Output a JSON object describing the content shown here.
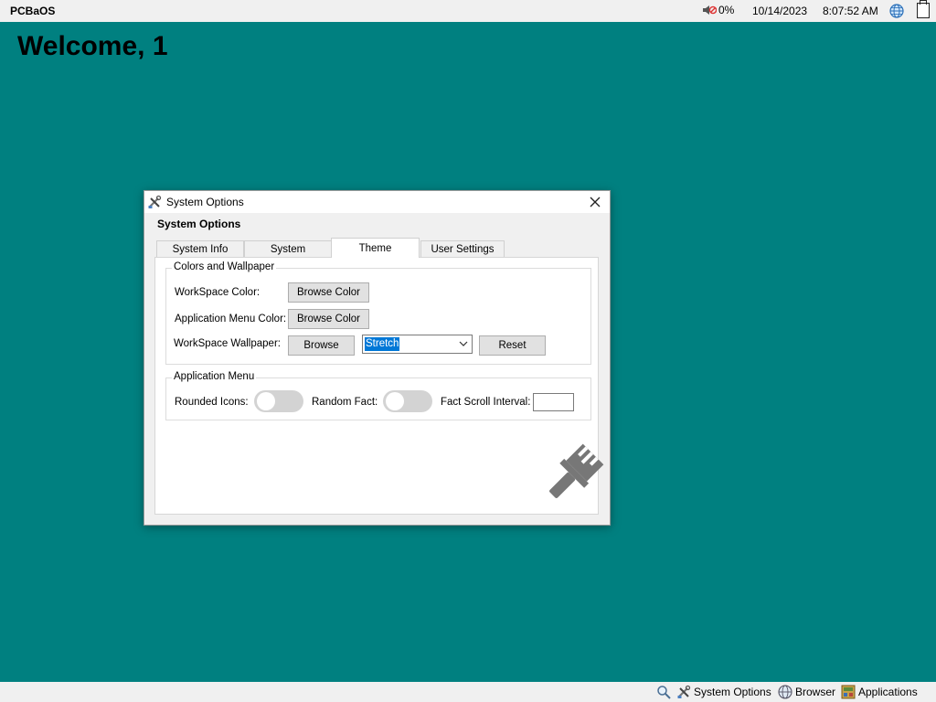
{
  "topbar": {
    "brand": "PCBaOS",
    "volume_icon": "speaker-muted-icon",
    "volume": "0%",
    "date": "10/14/2023",
    "time": "8:07:52 AM",
    "globe_icon": "globe-icon",
    "exit_icon": "exit-icon"
  },
  "desktop": {
    "welcome": "Welcome, 1",
    "background_color": "#008080"
  },
  "window": {
    "title": "System Options",
    "heading": "System Options",
    "close_icon": "close-icon",
    "tabs": [
      {
        "label": "System Info",
        "active": false
      },
      {
        "label": "System",
        "active": false
      },
      {
        "label": "Theme",
        "active": true
      },
      {
        "label": "User Settings",
        "active": false
      }
    ],
    "colors_group": {
      "title": "Colors and Wallpaper",
      "workspace_color_label": "WorkSpace Color:",
      "workspace_color_button": "Browse Color",
      "app_menu_color_label": "Application Menu Color:",
      "app_menu_color_button": "Browse Color",
      "wallpaper_label": "WorkSpace Wallpaper:",
      "wallpaper_browse_button": "Browse",
      "wallpaper_mode_selected": "Stretch",
      "wallpaper_reset_button": "Reset"
    },
    "app_menu_group": {
      "title": "Application Menu",
      "rounded_icons_label": "Rounded Icons:",
      "rounded_icons_on": false,
      "random_fact_label": "Random Fact:",
      "random_fact_on": false,
      "fact_scroll_label": "Fact Scroll Interval:",
      "fact_scroll_value": ""
    },
    "decor_icon": "paintbrush-icon"
  },
  "taskbar": {
    "search_icon": "search-icon",
    "items": [
      {
        "label": "System Options",
        "icon": "tools-icon"
      },
      {
        "label": "Browser",
        "icon": "globe-icon"
      },
      {
        "label": "Applications",
        "icon": "applications-icon"
      }
    ]
  }
}
